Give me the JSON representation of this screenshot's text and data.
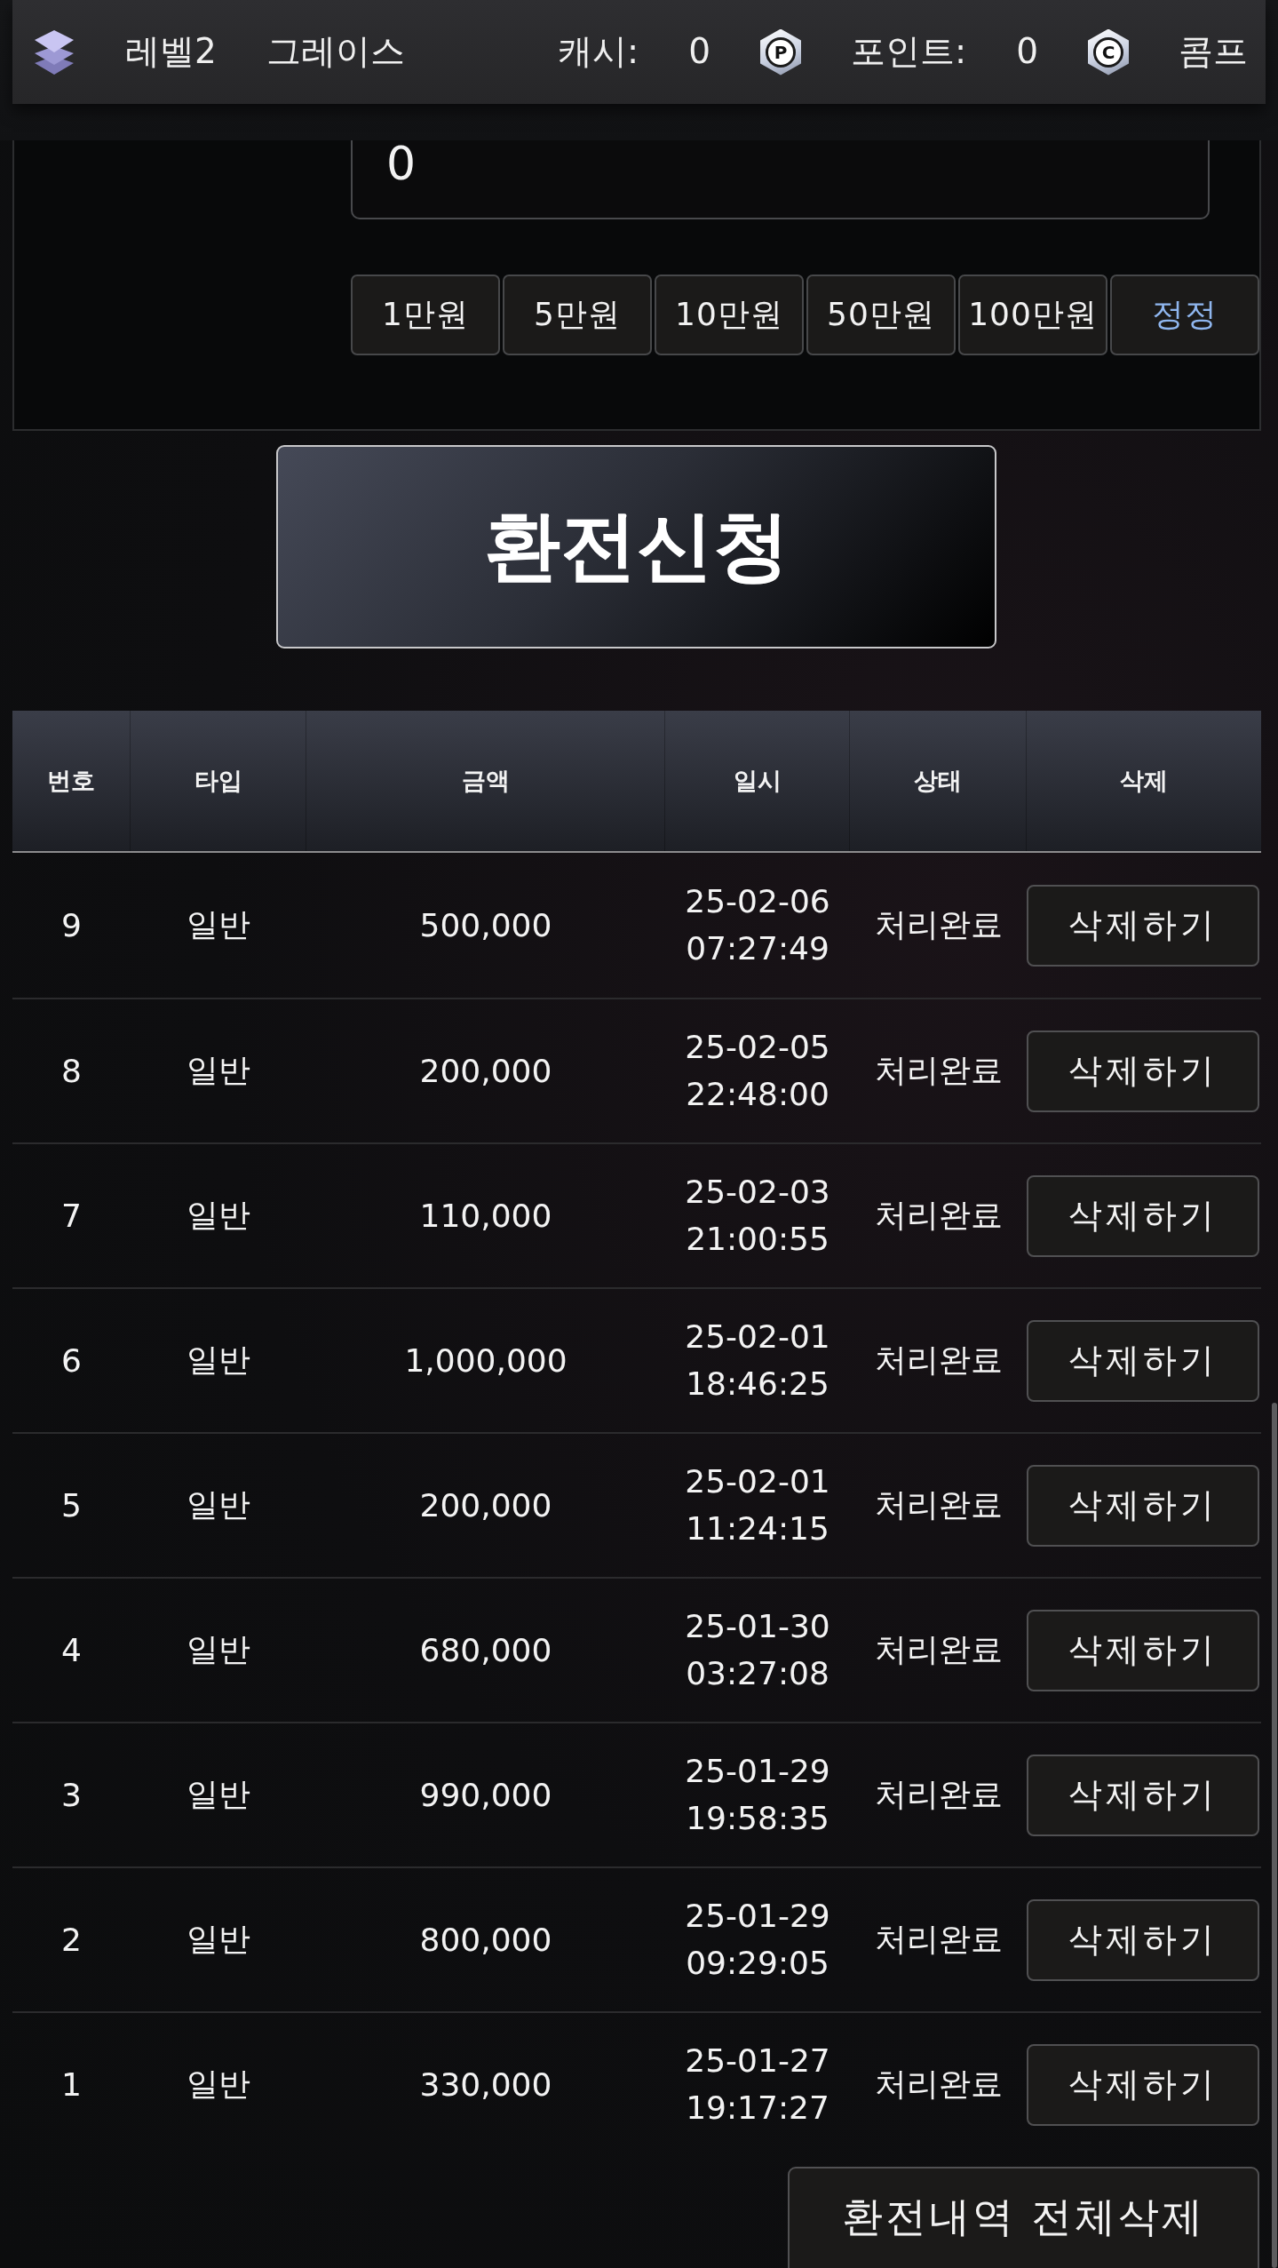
{
  "header": {
    "level": "레벨2",
    "grade": "그레이스",
    "balances": [
      {
        "label": "캐시:",
        "value": "0"
      },
      {
        "emblem": "P",
        "label": "포인트:",
        "value": "0"
      },
      {
        "emblem": "C",
        "label": "콤프"
      }
    ]
  },
  "exchange_form": {
    "amount_field": {
      "value": "0"
    },
    "quick_amounts": [
      {
        "label": "1만원",
        "kind": "add"
      },
      {
        "label": "5만원",
        "kind": "add"
      },
      {
        "label": "10만원",
        "kind": "add"
      },
      {
        "label": "50만원",
        "kind": "add"
      },
      {
        "label": "100만원",
        "kind": "add"
      },
      {
        "label": "정정",
        "kind": "reset"
      }
    ],
    "submit": "환전신청"
  },
  "history_table": {
    "columns": [
      "번호",
      "타입",
      "금액",
      "일시",
      "상태",
      "삭제"
    ],
    "rows": [
      {
        "number": "9",
        "type": "일반",
        "amount": "500,000",
        "datetime": "25-02-06 07:27:49",
        "status": "처리완료",
        "action": "삭제하기"
      },
      {
        "number": "8",
        "type": "일반",
        "amount": "200,000",
        "datetime": "25-02-05 22:48:00",
        "status": "처리완료",
        "action": "삭제하기"
      },
      {
        "number": "7",
        "type": "일반",
        "amount": "110,000",
        "datetime": "25-02-03 21:00:55",
        "status": "처리완료",
        "action": "삭제하기"
      },
      {
        "number": "6",
        "type": "일반",
        "amount": "1,000,000",
        "datetime": "25-02-01 18:46:25",
        "status": "처리완료",
        "action": "삭제하기"
      },
      {
        "number": "5",
        "type": "일반",
        "amount": "200,000",
        "datetime": "25-02-01 11:24:15",
        "status": "처리완료",
        "action": "삭제하기"
      },
      {
        "number": "4",
        "type": "일반",
        "amount": "680,000",
        "datetime": "25-01-30 03:27:08",
        "status": "처리완료",
        "action": "삭제하기"
      },
      {
        "number": "3",
        "type": "일반",
        "amount": "990,000",
        "datetime": "25-01-29 19:58:35",
        "status": "처리완료",
        "action": "삭제하기"
      },
      {
        "number": "2",
        "type": "일반",
        "amount": "800,000",
        "datetime": "25-01-29 09:29:05",
        "status": "처리완료",
        "action": "삭제하기"
      },
      {
        "number": "1",
        "type": "일반",
        "amount": "330,000",
        "datetime": "25-01-27 19:17:27",
        "status": "처리완료",
        "action": "삭제하기"
      }
    ]
  },
  "delete_all_button": "환전내역 전체삭제"
}
